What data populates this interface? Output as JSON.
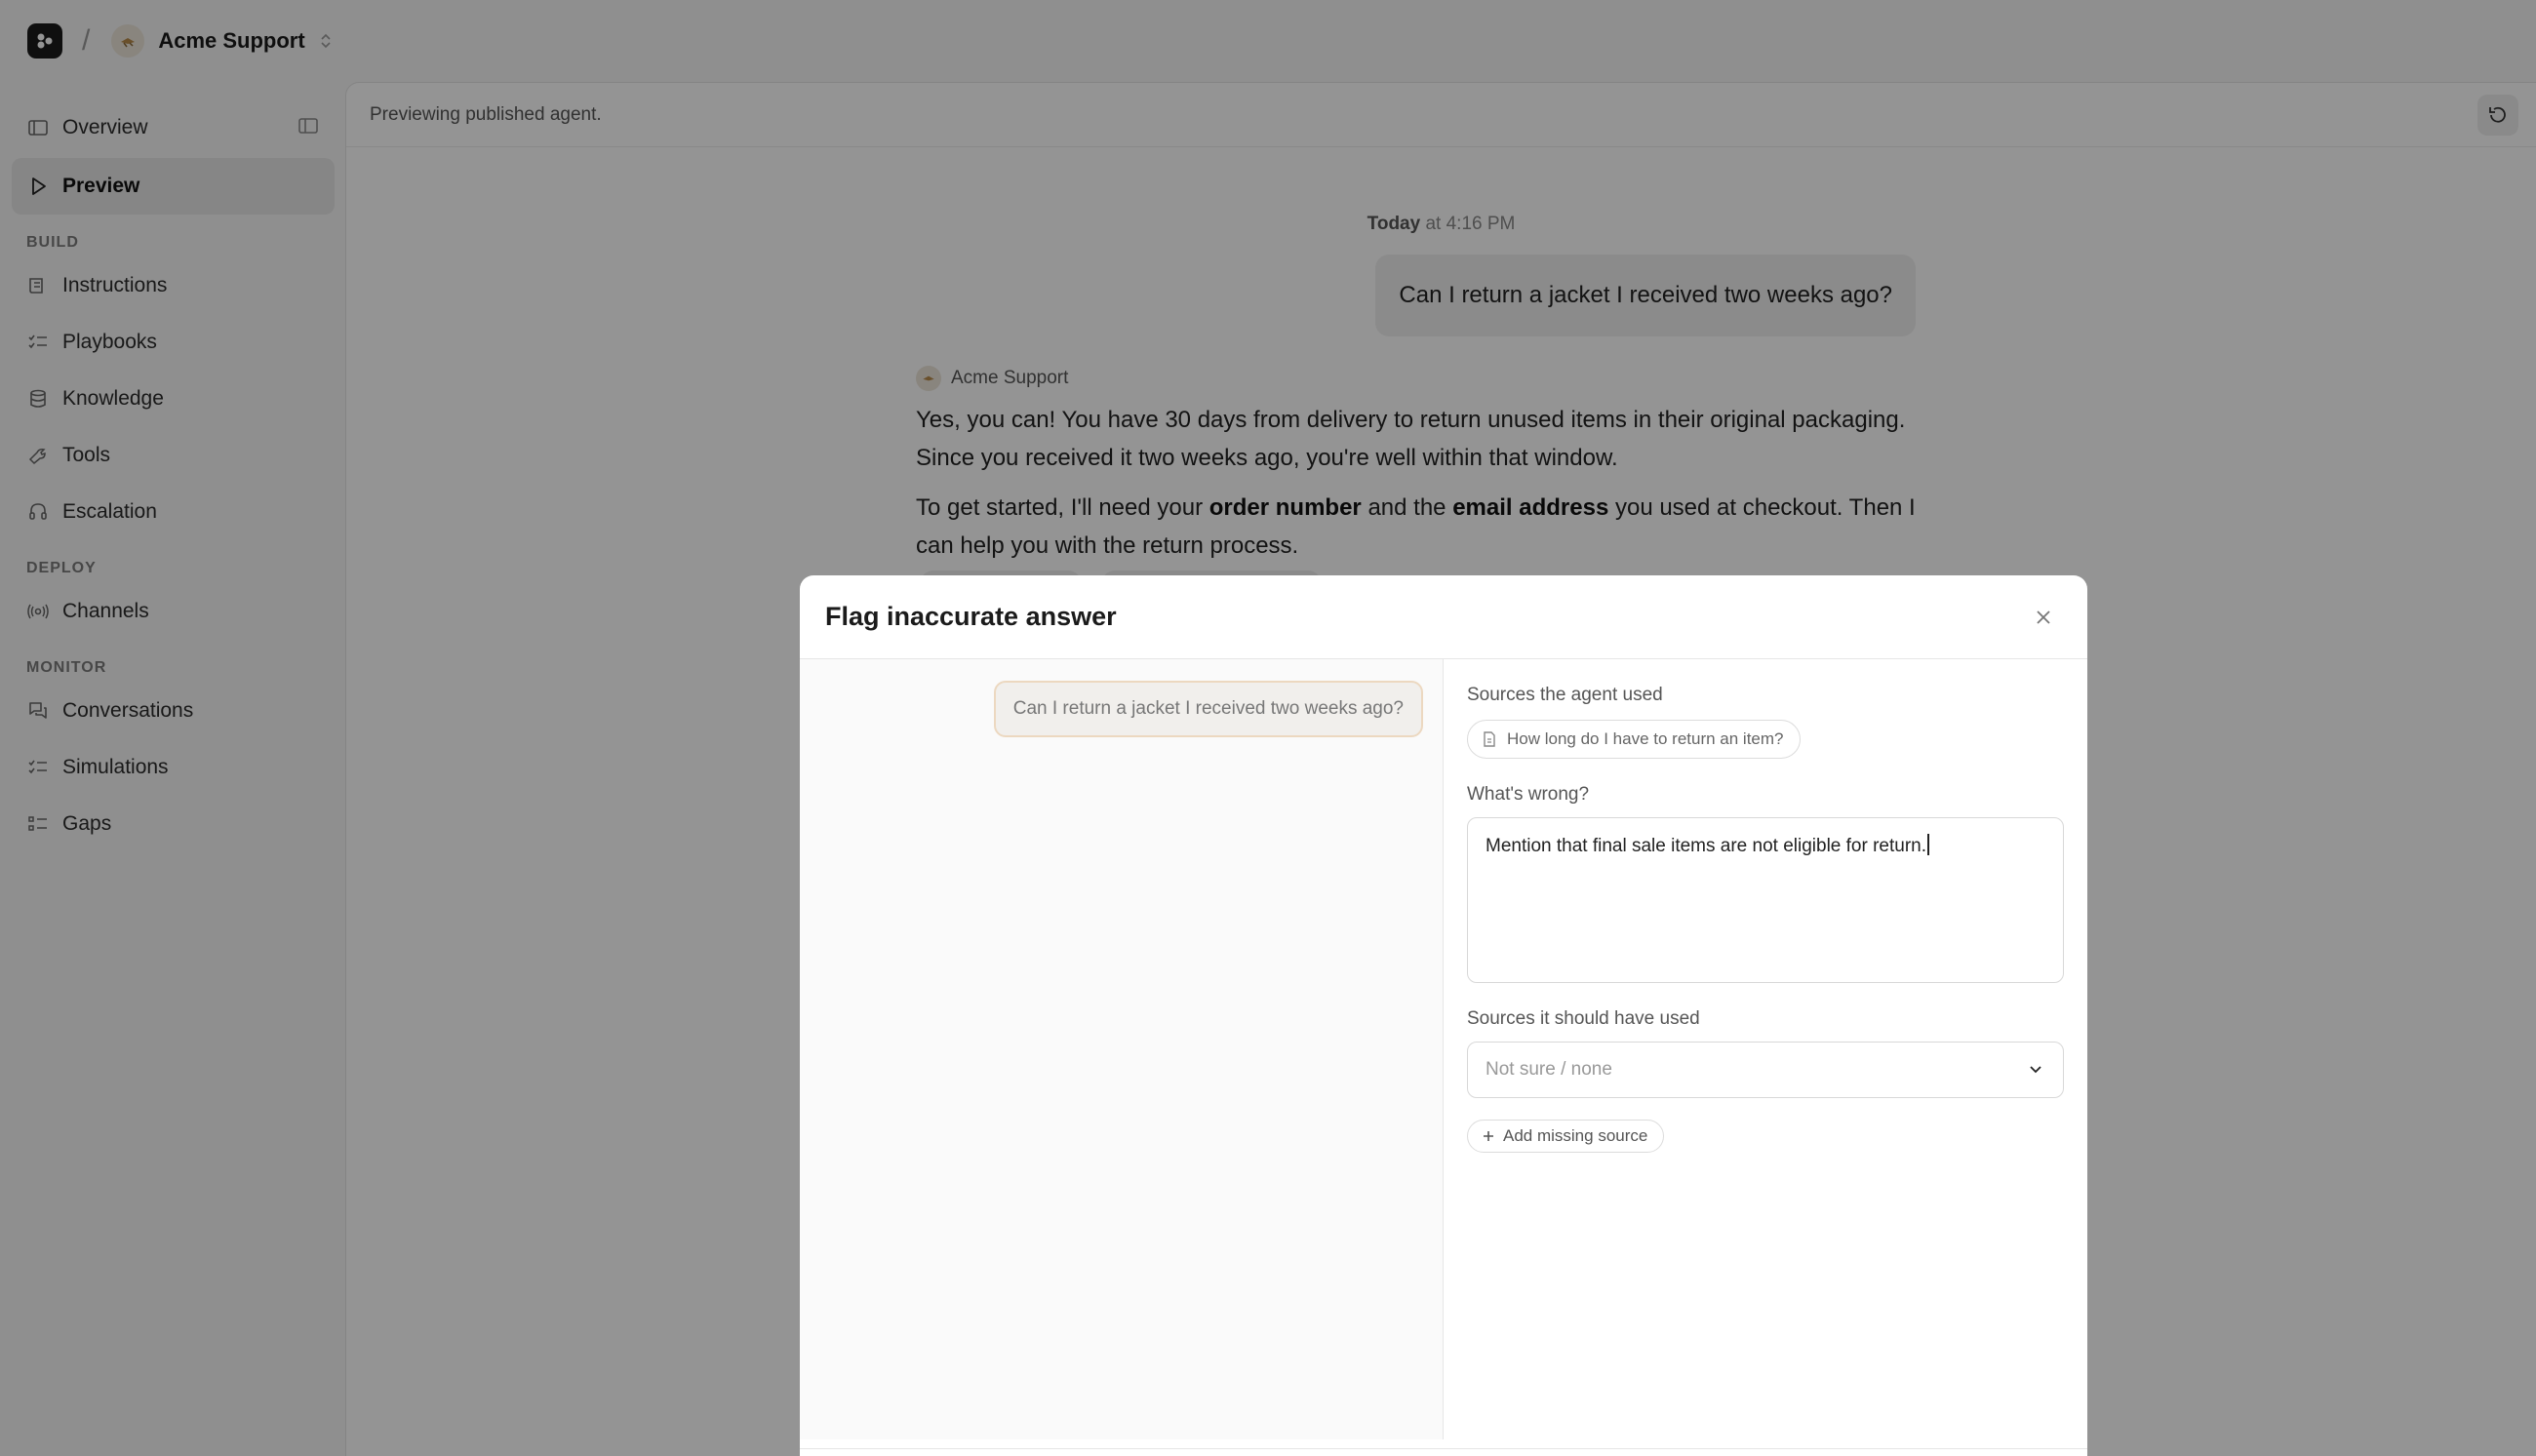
{
  "header": {
    "workspace_name": "Acme Support",
    "separator": "/"
  },
  "sidebar": {
    "items": [
      {
        "label": "Overview",
        "icon": "overview-icon"
      },
      {
        "label": "Preview",
        "icon": "play-icon",
        "active": true
      }
    ],
    "sections": [
      {
        "title": "BUILD",
        "items": [
          "Instructions",
          "Playbooks",
          "Knowledge",
          "Tools",
          "Escalation"
        ]
      },
      {
        "title": "DEPLOY",
        "items": [
          "Channels"
        ]
      },
      {
        "title": "MONITOR",
        "items": [
          "Conversations",
          "Simulations",
          "Gaps"
        ]
      }
    ]
  },
  "main": {
    "banner": "Previewing published agent.",
    "timestamp_day": "Today",
    "timestamp_time": "at 4:16 PM",
    "user_message": "Can I return a jacket I received two weeks ago?",
    "agent_name": "Acme Support",
    "agent_p1": "Yes, you can! You have 30 days from delivery to return unused items in their original packaging. Since you received it two weeks ago, you're well within that window.",
    "agent_p2_a": "To get started, I'll need your ",
    "agent_p2_b": "order number",
    "agent_p2_c": " and the ",
    "agent_p2_d": "email address",
    "agent_p2_e": " you used at checkout. Then I can help you with the return process."
  },
  "modal": {
    "title": "Flag inaccurate answer",
    "context_question": "Can I return a jacket I received two weeks ago?",
    "sources_used_label": "Sources the agent used",
    "source_chip": "How long do I have to return an item?",
    "whats_wrong_label": "What's wrong?",
    "whats_wrong_value": "Mention that final sale items are not eligible for return.",
    "sources_should_label": "Sources it should have used",
    "select_placeholder": "Not sure / none",
    "add_source_label": "Add missing source"
  },
  "colors": {
    "accent_dark": "#1b1b1b",
    "overlay": "rgba(0,0,0,0.42)",
    "highlight_border": "#ecd8c0"
  }
}
